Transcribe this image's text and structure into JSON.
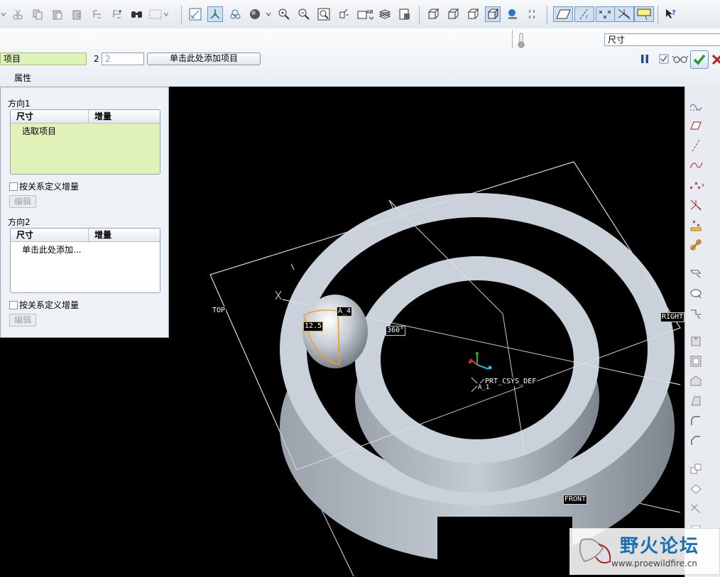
{
  "dashboard": {
    "collector_label": "项目",
    "count_prefix": "2",
    "count_value": "2",
    "add_item_label": "单击此处添加项目",
    "tab_properties": "属性",
    "dimension_select": "尺寸"
  },
  "panel": {
    "direction1_label": "方向1",
    "direction1_table": {
      "col_dimension": "尺寸",
      "col_increment": "增量",
      "row_text": "选取项目"
    },
    "direction1_relation_checkbox": "按关系定义增量",
    "direction1_edit_button": "编辑",
    "direction2_label": "方向2",
    "direction2_table": {
      "col_dimension": "尺寸",
      "col_increment": "增量",
      "row_text": "单击此处添加..."
    },
    "direction2_relation_checkbox": "按关系定义增量",
    "direction2_edit_button": "编辑"
  },
  "viewport": {
    "plane_top": "TOP",
    "plane_right": "RIGHT",
    "plane_front": "FRONT",
    "axis_a4": "A_4",
    "dim_radius": "12.5",
    "dim_angle": "360°",
    "csys_label": "PRT_CSYS_DEF",
    "axis_a1": "A_1"
  },
  "watermark": {
    "brand_text": "野火论坛",
    "url_text": "www.proewildfire.cn"
  },
  "icons": [
    "scissors-icon",
    "copy-icon",
    "paste-icon",
    "paste-special-icon",
    "regenerate-icon",
    "find-icon",
    "select-box-icon",
    "sketch-icon",
    "spin-center-icon",
    "layer-icon",
    "shading-icon",
    "zoom-in-icon",
    "zoom-out-icon",
    "refit-icon",
    "view-manager-icon",
    "datum-display-icon",
    "wireframe-icon",
    "hidden-line-icon",
    "no-hidden-icon",
    "shaded-icon",
    "enhanced-realism-icon",
    "datum-plane-display-icon",
    "datum-axis-display-icon",
    "datum-point-display-icon",
    "csys-display-icon",
    "annotation-display-icon",
    "whats-this-icon",
    "pause-icon",
    "preview-icon",
    "glasses-icon",
    "confirm-icon",
    "cancel-icon",
    "thermometer-icon"
  ],
  "colors": {
    "collector_bg": "#dff2b8",
    "confirm_green": "#2a9a2a",
    "part_face": "#c9d2da",
    "selected_edge": "#f0a020"
  }
}
